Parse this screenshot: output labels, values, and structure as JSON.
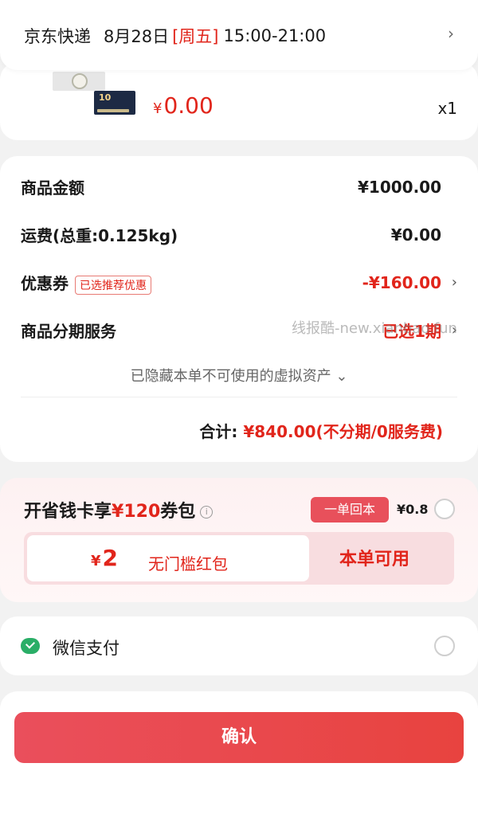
{
  "delivery": {
    "carrier": "京东快递",
    "date": "8月28日",
    "weekday": "[周五]",
    "time": "15:00-21:00",
    "chevron": "›"
  },
  "product": {
    "currency": "¥",
    "price": "0.00",
    "quantity": "x1",
    "thumb_text": "10"
  },
  "summary": {
    "goods_amount_label": "商品金额",
    "goods_amount_value": "¥1000.00",
    "shipping_label": "运费(总重:0.125kg)",
    "shipping_value": "¥0.00",
    "coupon_label": "优惠券",
    "coupon_tag": "已选推荐优惠",
    "coupon_value": "-¥160.00",
    "installment_label": "商品分期服务",
    "installment_value": "已选1期",
    "hidden_note": "已隐藏本单不可使用的虚拟资产",
    "hidden_chevron": "⌄",
    "total_label": "合计:",
    "total_value": "¥840.00(不分期/0服务费)",
    "chevron": "›"
  },
  "watermark": "线报酷-new.xianbao.fun",
  "promo": {
    "title_prefix": "开省钱卡享",
    "title_amount": "¥120",
    "title_suffix": "券包",
    "info_icon": "i",
    "badge": "一单回本",
    "price": "¥0.8",
    "coupon_currency": "¥",
    "coupon_amount": "2",
    "coupon_desc": "无门槛红包",
    "coupon_usable": "本单可用"
  },
  "payment": {
    "method": "微信支付",
    "icon": "wechat-icon"
  },
  "confirm_label": "确认",
  "colors": {
    "accent": "#e1251b",
    "button": "#e8433f",
    "wechat": "#2aae67"
  }
}
